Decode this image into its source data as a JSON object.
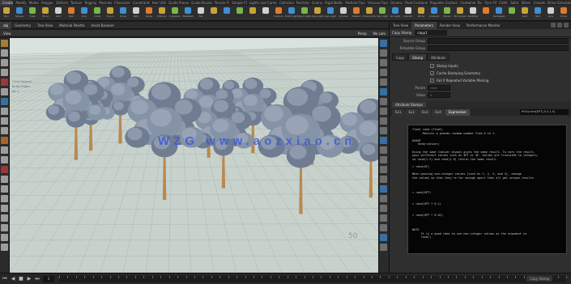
{
  "app": {
    "watermark": "WZG www.aozxiao.cn"
  },
  "shelf": {
    "tabs": [
      "Create",
      "Modify",
      "Model",
      "Polygon",
      "Deform",
      "Texture",
      "Rigging",
      "Muscles",
      "Characters",
      "Constraints",
      "Hair Utils",
      "Guide Process",
      "Guide Brushes",
      "Terrain FX",
      "Simple FX",
      "Lights and Cameras",
      "Collisions",
      "Particles",
      "Grains",
      "Rigid Bodies",
      "Particle Fluids",
      "Viscous Fluids",
      "Oceans",
      "Fluid Containers",
      "Populate Containers",
      "Container Tools",
      "Pyro FX",
      "Cloth",
      "Solid",
      "Wires",
      "Crowds",
      "Drive Simulation"
    ],
    "tools": [
      "Box",
      "Sphere",
      "Tube",
      "Torus",
      "Grid",
      "Null",
      "Line",
      "Circle",
      "Curve",
      "Draw",
      "Path",
      "Spray",
      "Platonic",
      "L-System",
      "Metaball",
      "File",
      "",
      "",
      "",
      "",
      "",
      "Camera",
      "Point Light",
      "Spot Light",
      "Area Light",
      "Geo Light",
      "Volume",
      "Distant",
      "Environment",
      "Sky Light",
      "GI Light",
      "Caustic",
      "Portal",
      "Ambient",
      "Stereo",
      "VR Camera",
      "Switcher",
      "",
      "Gamepad",
      "",
      "Grid",
      "Null",
      "Line",
      "Circle",
      "Box",
      "Sphere"
    ],
    "tool_colors": [
      "#c9a23a",
      "#3d8fd6",
      "#7ab648",
      "#c9a23a",
      "#d0d0d0",
      "#e07a2e",
      "#3d8fd6",
      "#7ab648",
      "#c9a23a",
      "#3d8fd6",
      "#d0d0d0",
      "#e07a2e",
      "#c9a23a",
      "#7ab648",
      "#3d8fd6",
      "#d0d0d0"
    ]
  },
  "pathbar": {
    "tabs": [
      "obj",
      "Geometry",
      "Tree View",
      "Material Palette",
      "Asset Browser"
    ]
  },
  "viewport": {
    "title": "View",
    "camera_menu": "Persp",
    "view_menu": "No cam",
    "hud_lines": [
      "Ortho Normal",
      "Bndry Edges",
      "Vis 1"
    ],
    "grid_label": "50",
    "background": "#d9e2dd",
    "ground": "#c8d2cd"
  },
  "timeline": {
    "frame": "1",
    "end": "240"
  },
  "params": {
    "pane_tabs": [
      "Tree View",
      "Parameters",
      "Render View",
      "Performance Monitor"
    ],
    "node_type": "Copy Stamp",
    "node_name": "copy1",
    "rows": [
      {
        "label": "Source Group",
        "value": ""
      },
      {
        "label": "Template Group",
        "value": ""
      }
    ],
    "tabs": [
      "Copy",
      "Stamp",
      "Attribute"
    ],
    "checks": [
      {
        "label": "Stamp Inputs",
        "checked": true
      },
      {
        "label": "Cache Stamping Geometry",
        "checked": false
      },
      {
        "label": "Fail if Repeated Variable Missing",
        "checked": false
      }
    ],
    "vars": [
      {
        "label": "Param",
        "value": "rand"
      },
      {
        "label": "Value",
        "value": "0"
      }
    ],
    "snippet_label": "Attribute Stamps",
    "code_tabs": [
      "Ex1",
      "Ex2",
      "Ex3",
      "Ex4",
      "Expression"
    ],
    "code_input": "fit01(rand($PT),0.5,1.5)",
    "node_info": "Copy Stamp"
  },
  "help": {
    "lines": [
      "float rand (float)",
      "      Returns a pseudo-random number from 0 to 1.",
      "",
      "USAGE",
      "   rand(<value>)",
      "",
      "Using the same <value> always gives the same result. To vary the result,",
      "pass different values such as $PT or $F. Values are truncated to integers,",
      "so rand(1.2) and rand(1.9) return the same result.",
      "",
      "> rand($F)",
      "",
      "When passing non-integer values (such as 1, 2, 3, and 4), change",
      "the values so that they're far enough apart that all get unique results.",
      "",
      "",
      "",
      "> rand($PT)",
      "",
      "",
      "> rand($PT * 0.1)",
      "",
      "",
      "> rand($PT * 0.01)",
      "",
      "",
      "",
      "NOTE",
      "     It is a good idea to use non-integer values as the argument to",
      "     rand()."
    ]
  },
  "trees": [
    {
      "x": 0.18,
      "base": 0.52,
      "h": 0.38
    },
    {
      "x": 0.3,
      "base": 0.45,
      "h": 0.33
    },
    {
      "x": 0.42,
      "base": 0.69,
      "h": 0.5
    },
    {
      "x": 0.54,
      "base": 0.51,
      "h": 0.34
    },
    {
      "x": 0.6,
      "base": 0.44,
      "h": 0.26
    },
    {
      "x": 0.58,
      "base": 0.64,
      "h": 0.38
    },
    {
      "x": 0.66,
      "base": 0.49,
      "h": 0.32
    },
    {
      "x": 0.79,
      "base": 0.75,
      "h": 0.54
    },
    {
      "x": 0.82,
      "base": 0.54,
      "h": 0.36
    },
    {
      "x": 0.22,
      "base": 0.48,
      "h": 0.3
    },
    {
      "x": 0.98,
      "base": 0.68,
      "h": 0.42
    }
  ]
}
